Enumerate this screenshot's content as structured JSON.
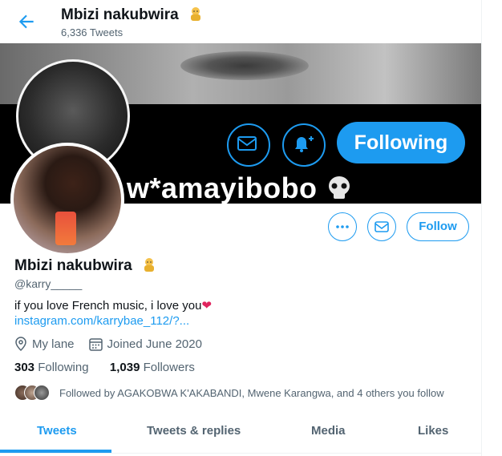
{
  "header": {
    "title": "Mbizi nakubwira",
    "tweet_count": "6,336 Tweets"
  },
  "banner": {
    "button_label": "Following",
    "text": "w*amayibobo"
  },
  "actions": {
    "more_icon": "more-icon",
    "message_icon": "mail-icon",
    "follow_label": "Follow"
  },
  "profile": {
    "name": "Mbizi nakubwira",
    "handle": "@karry_____",
    "bio": "if you love French music, i love you",
    "bio_emoji": "❤",
    "link": "instagram.com/karrybae_112/?...",
    "location": "My lane",
    "joined": "Joined June 2020"
  },
  "stats": {
    "following_count": "303",
    "following_label": "Following",
    "followers_count": "1,039",
    "followers_label": "Followers"
  },
  "followed_by": "Followed by AGAKOBWA K'AKABANDI, Mwene Karangwa, and 4 others you follow",
  "tabs": [
    {
      "label": "Tweets",
      "active": true
    },
    {
      "label": "Tweets & replies",
      "active": false
    },
    {
      "label": "Media",
      "active": false
    },
    {
      "label": "Likes",
      "active": false
    }
  ],
  "colors": {
    "accent": "#1d9bf0",
    "text": "#0f1419",
    "secondary": "#536471"
  }
}
